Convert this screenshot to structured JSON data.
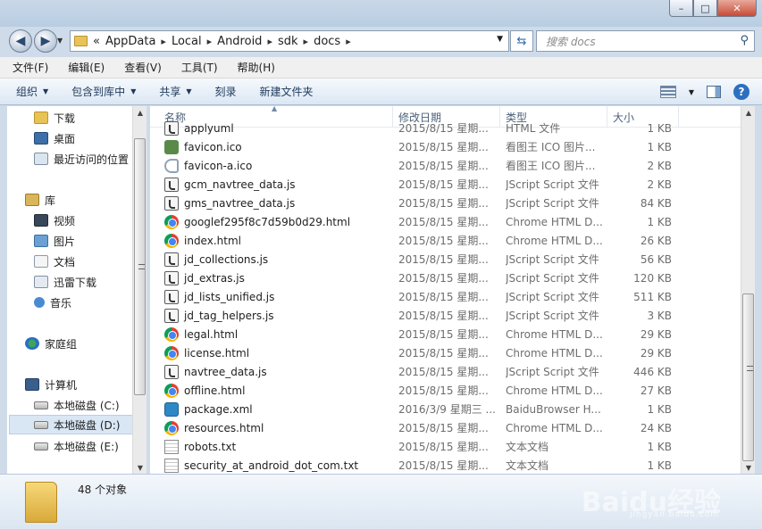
{
  "window": {
    "minimize_glyph": "–",
    "maximize_glyph": "□",
    "close_glyph": "✕"
  },
  "address": {
    "overflow_glyph": "«",
    "crumbs": [
      "AppData",
      "Local",
      "Android",
      "sdk",
      "docs"
    ],
    "search_placeholder": "搜索 docs"
  },
  "menu": [
    "文件(F)",
    "编辑(E)",
    "查看(V)",
    "工具(T)",
    "帮助(H)"
  ],
  "toolbar": {
    "organize": "组织",
    "include_library": "包含到库中",
    "share": "共享",
    "burn": "刻录",
    "new_folder": "新建文件夹"
  },
  "nav": {
    "downloads": "下载",
    "desktop": "桌面",
    "recent": "最近访问的位置",
    "libraries": "库",
    "videos": "视频",
    "pictures": "图片",
    "documents": "文档",
    "thunder": "迅雷下载",
    "music": "音乐",
    "homegroup": "家庭组",
    "computer": "计算机",
    "drive_c": "本地磁盘 (C:)",
    "drive_d": "本地磁盘 (D:)",
    "drive_e": "本地磁盘 (E:)"
  },
  "columns": {
    "name": "名称",
    "date": "修改日期",
    "type": "类型",
    "size": "大小"
  },
  "files": [
    {
      "name": "applyuml",
      "date": "2015/8/15 星期...",
      "type": "HTML 文件",
      "size": "1 KB",
      "icon": "js-icon"
    },
    {
      "name": "favicon.ico",
      "date": "2015/8/15 星期...",
      "type": "看图王 ICO 图片...",
      "size": "1 KB",
      "icon": "ico-icon"
    },
    {
      "name": "favicon-a.ico",
      "date": "2015/8/15 星期...",
      "type": "看图王 ICO 图片...",
      "size": "2 KB",
      "icon": "ico-alt-icon"
    },
    {
      "name": "gcm_navtree_data.js",
      "date": "2015/8/15 星期...",
      "type": "JScript Script 文件",
      "size": "2 KB",
      "icon": "js-icon"
    },
    {
      "name": "gms_navtree_data.js",
      "date": "2015/8/15 星期...",
      "type": "JScript Script 文件",
      "size": "84 KB",
      "icon": "js-icon"
    },
    {
      "name": "googlef295f8c7d59b0d29.html",
      "date": "2015/8/15 星期...",
      "type": "Chrome HTML D...",
      "size": "1 KB",
      "icon": "chrome-icon"
    },
    {
      "name": "index.html",
      "date": "2015/8/15 星期...",
      "type": "Chrome HTML D...",
      "size": "26 KB",
      "icon": "chrome-icon"
    },
    {
      "name": "jd_collections.js",
      "date": "2015/8/15 星期...",
      "type": "JScript Script 文件",
      "size": "56 KB",
      "icon": "js-icon"
    },
    {
      "name": "jd_extras.js",
      "date": "2015/8/15 星期...",
      "type": "JScript Script 文件",
      "size": "120 KB",
      "icon": "js-icon"
    },
    {
      "name": "jd_lists_unified.js",
      "date": "2015/8/15 星期...",
      "type": "JScript Script 文件",
      "size": "511 KB",
      "icon": "js-icon"
    },
    {
      "name": "jd_tag_helpers.js",
      "date": "2015/8/15 星期...",
      "type": "JScript Script 文件",
      "size": "3 KB",
      "icon": "js-icon"
    },
    {
      "name": "legal.html",
      "date": "2015/8/15 星期...",
      "type": "Chrome HTML D...",
      "size": "29 KB",
      "icon": "chrome-icon"
    },
    {
      "name": "license.html",
      "date": "2015/8/15 星期...",
      "type": "Chrome HTML D...",
      "size": "29 KB",
      "icon": "chrome-icon"
    },
    {
      "name": "navtree_data.js",
      "date": "2015/8/15 星期...",
      "type": "JScript Script 文件",
      "size": "446 KB",
      "icon": "js-icon"
    },
    {
      "name": "offline.html",
      "date": "2015/8/15 星期...",
      "type": "Chrome HTML D...",
      "size": "27 KB",
      "icon": "chrome-icon"
    },
    {
      "name": "package.xml",
      "date": "2016/3/9 星期三 ...",
      "type": "BaiduBrowser H...",
      "size": "1 KB",
      "icon": "xml-icon"
    },
    {
      "name": "resources.html",
      "date": "2015/8/15 星期...",
      "type": "Chrome HTML D...",
      "size": "24 KB",
      "icon": "chrome-icon"
    },
    {
      "name": "robots.txt",
      "date": "2015/8/15 星期...",
      "type": "文本文档",
      "size": "1 KB",
      "icon": "txt-icon"
    },
    {
      "name": "security_at_android_dot_com.txt",
      "date": "2015/8/15 星期...",
      "type": "文本文档",
      "size": "1 KB",
      "icon": "txt-icon"
    }
  ],
  "status": {
    "count": "48 个对象"
  },
  "watermark": {
    "brand": "Baidu经验",
    "url": "jingyan.baidu.com"
  }
}
